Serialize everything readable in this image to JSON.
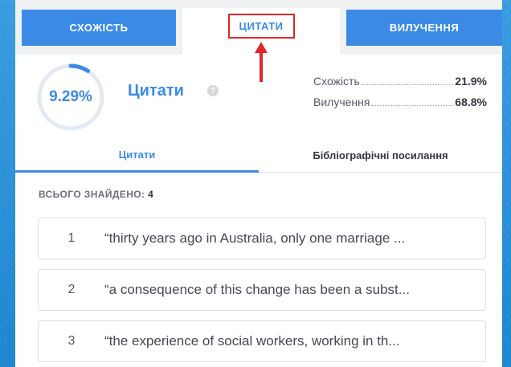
{
  "tabs": {
    "similarity": "СХОЖІСТЬ",
    "citations": "ЦИТАТИ",
    "exclusions": "ВИЛУЧЕННЯ"
  },
  "summary": {
    "score": "9.29%",
    "score_fraction": 0.0929,
    "title": "Цитати",
    "help_icon": "?",
    "stats": [
      {
        "label": "Схожість",
        "value": "21.9%"
      },
      {
        "label": "Вилучення",
        "value": "68.8%"
      }
    ]
  },
  "subtabs": {
    "citations": "Цитати",
    "bibliography": "Бібліографічні посилання"
  },
  "found": {
    "label": "ВСЬОГО ЗНАЙДЕНО:",
    "count": "4"
  },
  "quotes": [
    {
      "num": "1",
      "text": "“thirty years ago in Australia, only one marriage ..."
    },
    {
      "num": "2",
      "text": "“a consequence of this change has been a subst..."
    },
    {
      "num": "3",
      "text": "“the experience of social workers, working in th..."
    }
  ],
  "colors": {
    "accent": "#3b8be6",
    "highlight": "#e0262a"
  }
}
